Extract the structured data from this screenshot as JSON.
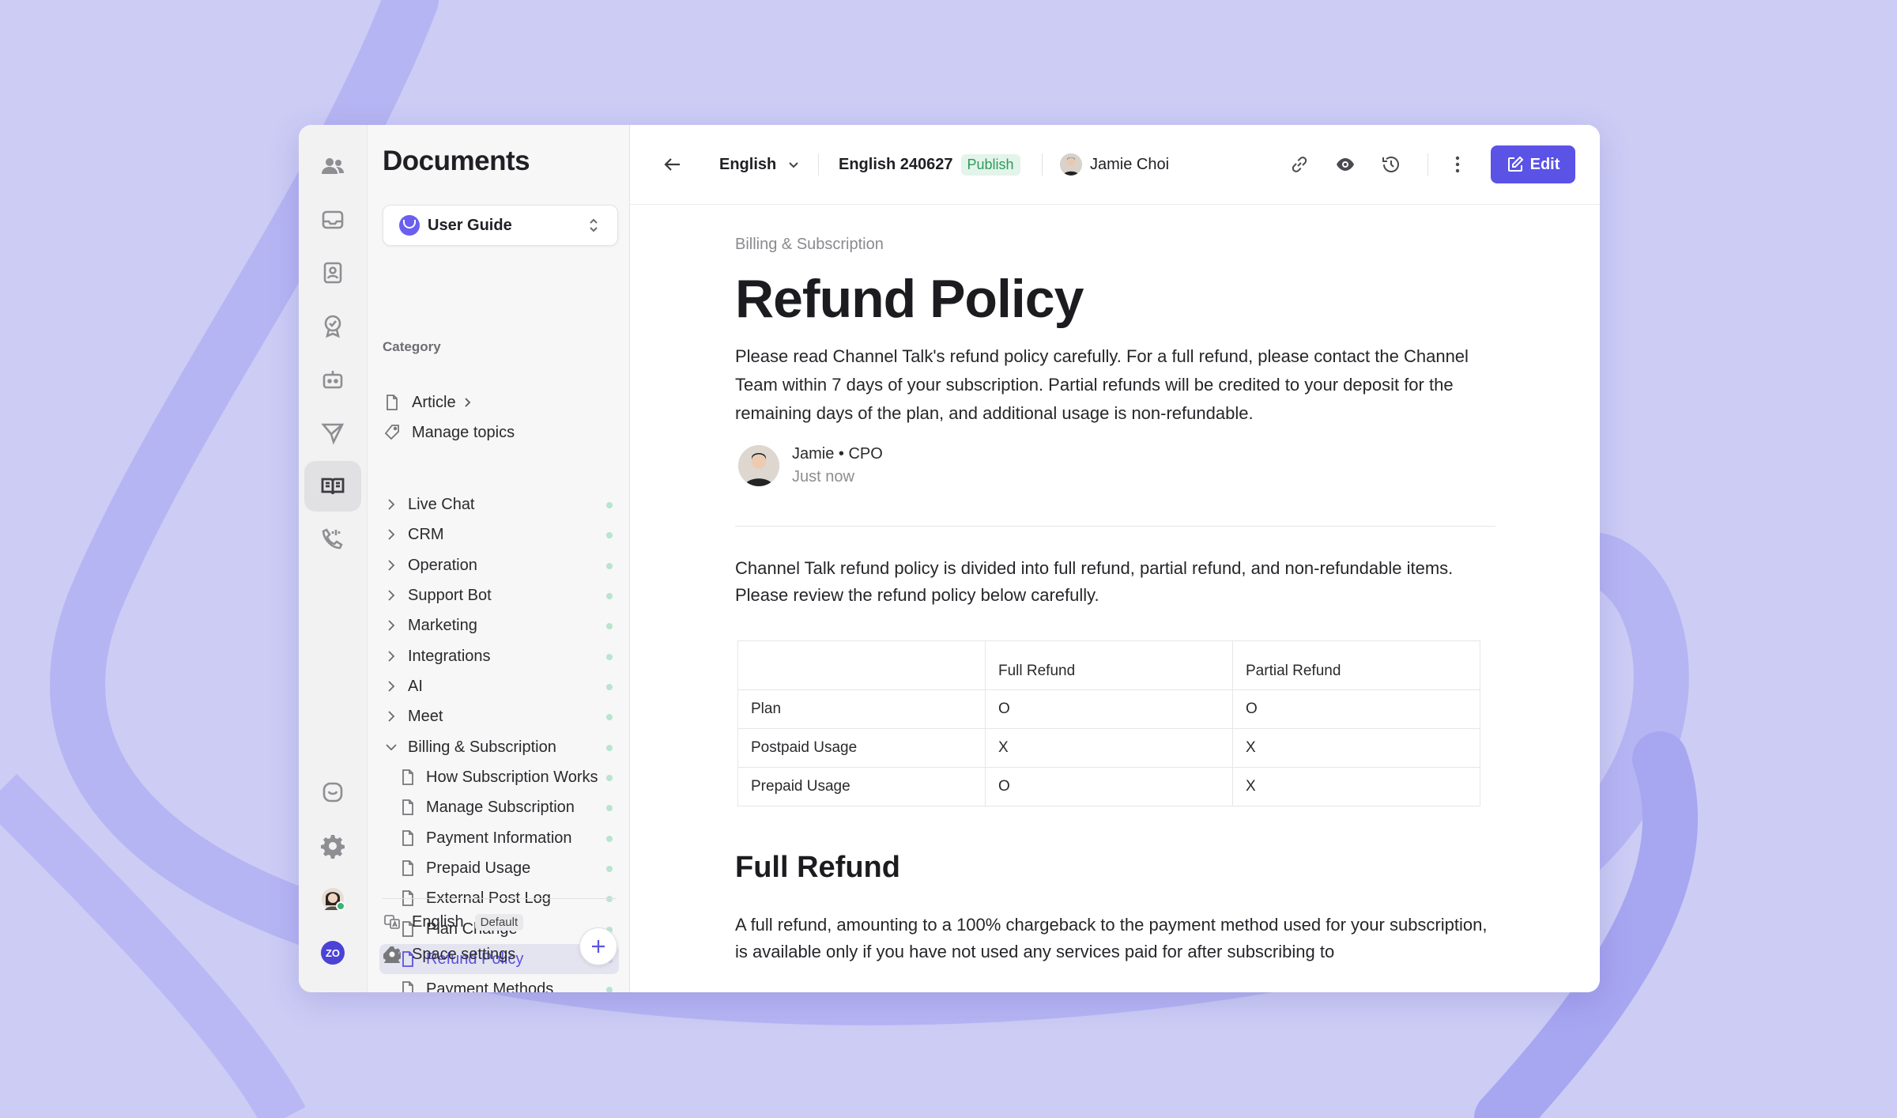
{
  "sidebar": {
    "title": "Documents",
    "space_name": "User Guide",
    "article_label": "Article",
    "manage_topics_label": "Manage topics",
    "category_label": "Category",
    "categories": [
      {
        "label": "Live Chat"
      },
      {
        "label": "CRM"
      },
      {
        "label": "Operation"
      },
      {
        "label": "Support Bot"
      },
      {
        "label": "Marketing"
      },
      {
        "label": "Integrations"
      },
      {
        "label": "AI"
      },
      {
        "label": "Meet"
      },
      {
        "label": "Billing & Subscription"
      }
    ],
    "articles": [
      {
        "label": "How Subscription Works"
      },
      {
        "label": "Manage Subscription"
      },
      {
        "label": "Payment Information"
      },
      {
        "label": "Prepaid Usage"
      },
      {
        "label": "External Post Log"
      },
      {
        "label": "Plan Change"
      },
      {
        "label": "Refund Policy"
      },
      {
        "label": "Payment Methods"
      }
    ],
    "language_label": "English",
    "default_badge": "Default",
    "space_settings_label": "Space settings"
  },
  "topbar": {
    "language": "English",
    "version": "English 240627",
    "status": "Publish",
    "author": "Jamie Choi",
    "edit_label": "Edit"
  },
  "article": {
    "breadcrumb": "Billing & Subscription",
    "title": "Refund Policy",
    "lead": "Please read Channel Talk's refund policy carefully. For a full refund, please contact the Channel Team within 7 days of your subscription. Partial refunds will be credited to your deposit for the remaining days of the plan, and additional usage is non-refundable.",
    "author_line": "Jamie • CPO",
    "author_time": "Just now",
    "intro": "Channel Talk refund policy is divided into full refund, partial refund, and non-refundable items. Please review the refund policy below carefully.",
    "table": {
      "headers": [
        "",
        "Full Refund",
        "Partial Refund"
      ],
      "rows": [
        [
          "Plan",
          "O",
          "O"
        ],
        [
          "Postpaid Usage",
          "X",
          "X"
        ],
        [
          "Prepaid Usage",
          "O",
          "X"
        ]
      ]
    },
    "section_title": "Full Refund",
    "section_text": "A full refund, amounting to a 100% chargeback to the payment method used for your subscription, is available only if you have not used any services paid for after subscribing to"
  },
  "colors": {
    "accent": "#5b52e6",
    "background": "#ccccf5",
    "publish": "#2f9a5c"
  }
}
